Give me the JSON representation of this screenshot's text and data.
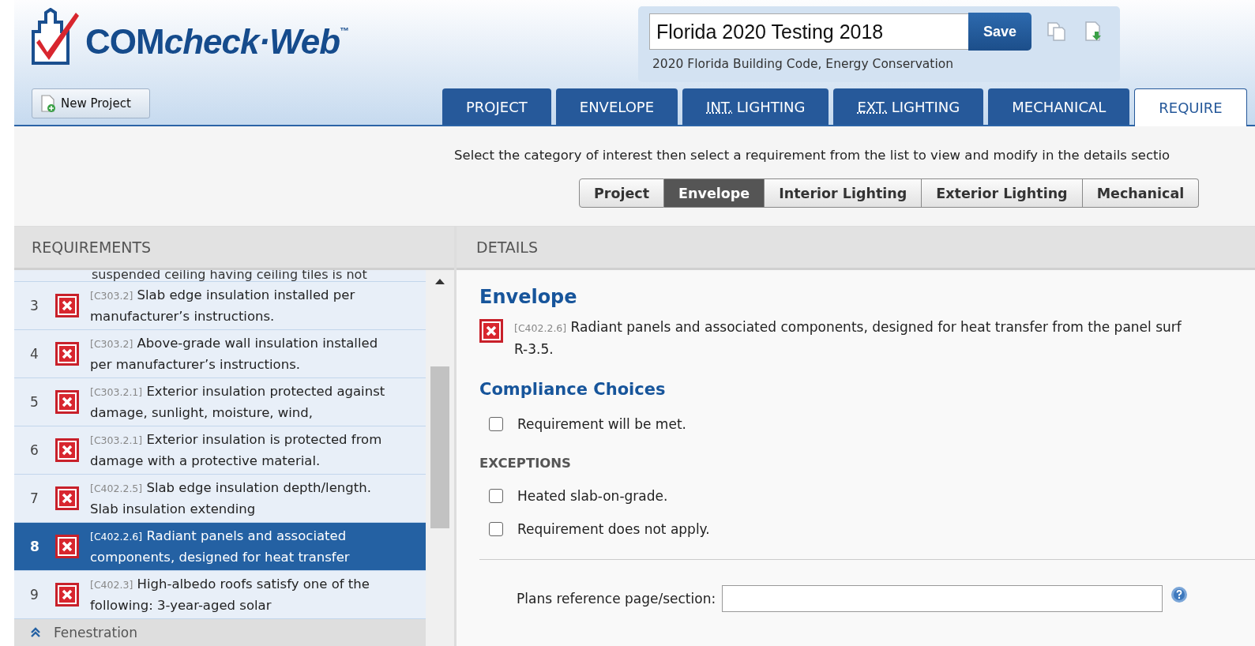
{
  "logo": {
    "brand_bold": "COM",
    "brand_italic": "check·Web",
    "trademark": "™"
  },
  "new_project_button": "New Project",
  "project": {
    "name": "Florida 2020 Testing 2018",
    "save_button": "Save",
    "code": "2020 Florida Building Code, Energy Conservation"
  },
  "tabs": [
    {
      "label": "PROJECT",
      "selected": false
    },
    {
      "label": "ENVELOPE",
      "selected": false
    },
    {
      "abbr": "INT.",
      "label": "LIGHTING",
      "selected": false
    },
    {
      "abbr": "EXT.",
      "label": "LIGHTING",
      "selected": false
    },
    {
      "label": "MECHANICAL",
      "selected": false
    },
    {
      "label": "REQUIRE",
      "selected": true
    }
  ],
  "instructions": "Select the category of interest then select a requirement from the list to view and modify in the details sectio",
  "categories": [
    {
      "label": "Project",
      "selected": false
    },
    {
      "label": "Envelope",
      "selected": true
    },
    {
      "label": "Interior Lighting",
      "selected": false
    },
    {
      "label": "Exterior Lighting",
      "selected": false
    },
    {
      "label": "Mechanical",
      "selected": false
    }
  ],
  "requirements": {
    "title": "REQUIREMENTS",
    "partial_text": "suspended ceiling having ceiling tiles is not",
    "items": [
      {
        "number": "3",
        "code": "[C303.2]",
        "text": "Slab edge insulation installed per manufacturer’s instructions.",
        "selected": false
      },
      {
        "number": "4",
        "code": "[C303.2]",
        "text": "Above-grade wall insulation installed per manufacturer’s instructions.",
        "selected": false
      },
      {
        "number": "5",
        "code": "[C303.2.1]",
        "text": "Exterior insulation protected against damage, sunlight, moisture, wind,",
        "selected": false
      },
      {
        "number": "6",
        "code": "[C303.2.1]",
        "text": "Exterior insulation is protected from damage with a protective material.",
        "selected": false
      },
      {
        "number": "7",
        "code": "[C402.2.5]",
        "text": "Slab edge insulation depth/length. Slab insulation extending",
        "selected": false
      },
      {
        "number": "8",
        "code": "[C402.2.6]",
        "text": "Radiant panels and associated components, designed for heat transfer",
        "selected": true
      },
      {
        "number": "9",
        "code": "[C402.3]",
        "text": "High-albedo roofs satisfy one of the following: 3-year-aged solar",
        "selected": false
      }
    ],
    "group": "Fenestration"
  },
  "details": {
    "title": "DETAILS",
    "heading": "Envelope",
    "code": "[C402.2.6]",
    "text": "Radiant panels and associated components, designed for heat transfer from the panel surf",
    "text_line_2": "R-3.5.",
    "compliance_heading": "Compliance Choices",
    "choices": [
      {
        "label": "Requirement will be met.",
        "checked": false
      }
    ],
    "exceptions_heading": "EXCEPTIONS",
    "exceptions": [
      {
        "label": "Heated slab-on-grade.",
        "checked": false
      },
      {
        "label": "Requirement does not apply.",
        "checked": false
      }
    ],
    "plans_label": "Plans reference page/section:"
  }
}
